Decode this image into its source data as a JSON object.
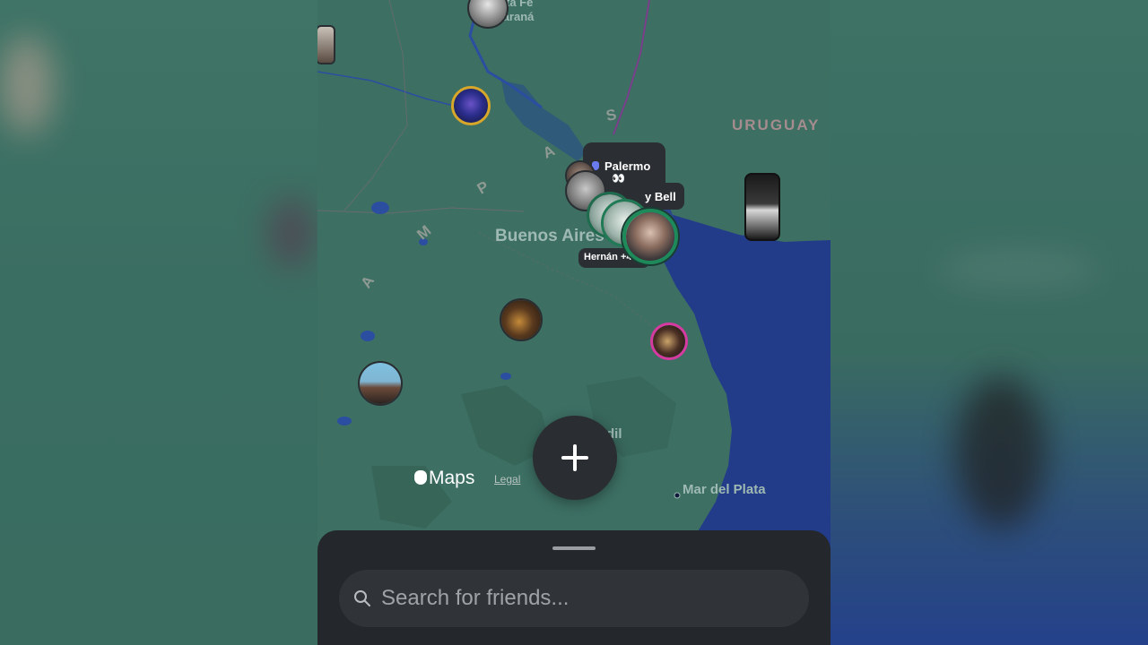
{
  "map": {
    "country_label": "URUGUAY",
    "pampas_letters": [
      "S",
      "A",
      "P",
      "M",
      "A"
    ],
    "cities": {
      "top_line1": "ta Fe",
      "top_line2": "Paraná",
      "buenos_aires": "Buenos Aires",
      "tandil_partial": "dil",
      "mar_del_plata": "Mar del Plata"
    },
    "cluster": {
      "location_label": "Palermo",
      "emoji": "👀",
      "name_partial": "y Bell",
      "names_label": "Hernán +4"
    },
    "attribution": {
      "brand": "Maps",
      "legal_link": "Legal"
    }
  },
  "actions": {
    "add_symbol": "+"
  },
  "search": {
    "placeholder": "Search for friends..."
  },
  "colors": {
    "land": "#3d6f63",
    "ocean": "#233c8a",
    "river": "#2c4ea0",
    "sheet": "#24272b",
    "search_field": "#303338"
  }
}
